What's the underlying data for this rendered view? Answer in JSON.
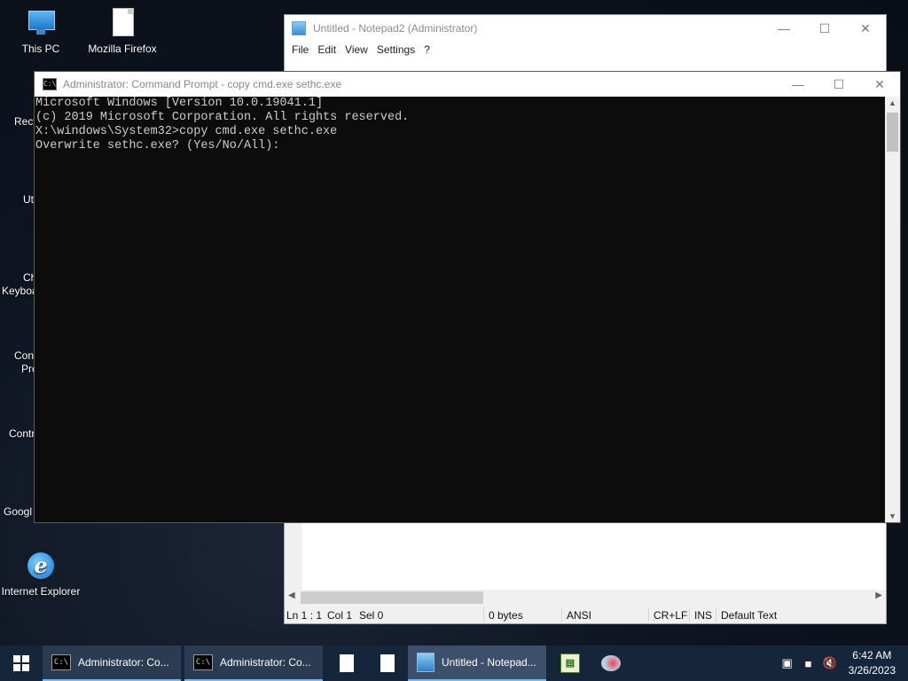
{
  "desktop": {
    "icons": [
      {
        "label": "This PC",
        "icon": "computer-icon"
      },
      {
        "label": "Mozilla Firefox",
        "icon": "file-icon"
      },
      {
        "label": "Internet Explorer",
        "icon": "internet-explorer-icon"
      }
    ],
    "partial_labels": [
      "Recy",
      "Ut",
      "Ch",
      "Keyboa",
      "Con",
      "Pro",
      "Contr",
      "Googl"
    ]
  },
  "notepad": {
    "title": "Untitled - Notepad2 (Administrator)",
    "menu": [
      "File",
      "Edit",
      "View",
      "Settings",
      "?"
    ],
    "status": {
      "ln": "Ln 1 : 1",
      "col": "Col 1",
      "sel": "Sel 0",
      "size": "0 bytes",
      "encoding": "ANSI",
      "eol": "CR+LF",
      "mode": "INS",
      "scheme": "Default Text"
    }
  },
  "cmd": {
    "title": "Administrator: Command Prompt - copy  cmd.exe sethc.exe",
    "lines": [
      "Microsoft Windows [Version 10.0.19041.1]",
      "(c) 2019 Microsoft Corporation. All rights reserved.",
      "",
      "X:\\windows\\System32>copy cmd.exe sethc.exe",
      "Overwrite sethc.exe? (Yes/No/All):"
    ]
  },
  "taskbar": {
    "items": [
      {
        "label": "Administrator: Co...",
        "icon": "command-prompt-icon"
      },
      {
        "label": "Administrator: Co...",
        "icon": "command-prompt-icon"
      },
      {
        "label": "",
        "icon": "file-icon"
      },
      {
        "label": "",
        "icon": "file-icon"
      },
      {
        "label": "Untitled - Notepad...",
        "icon": "notepad-icon"
      },
      {
        "label": "",
        "icon": "spreadsheet-icon"
      },
      {
        "label": "",
        "icon": "paint-icon"
      }
    ],
    "clock": {
      "time": "6:42 AM",
      "date": "3/26/2023"
    }
  },
  "colors": {
    "console_bg": "#0c0c0c",
    "console_fg": "#cccccc",
    "taskbar_bg": "#15253a",
    "taskbar_accent": "#76b9ed"
  }
}
